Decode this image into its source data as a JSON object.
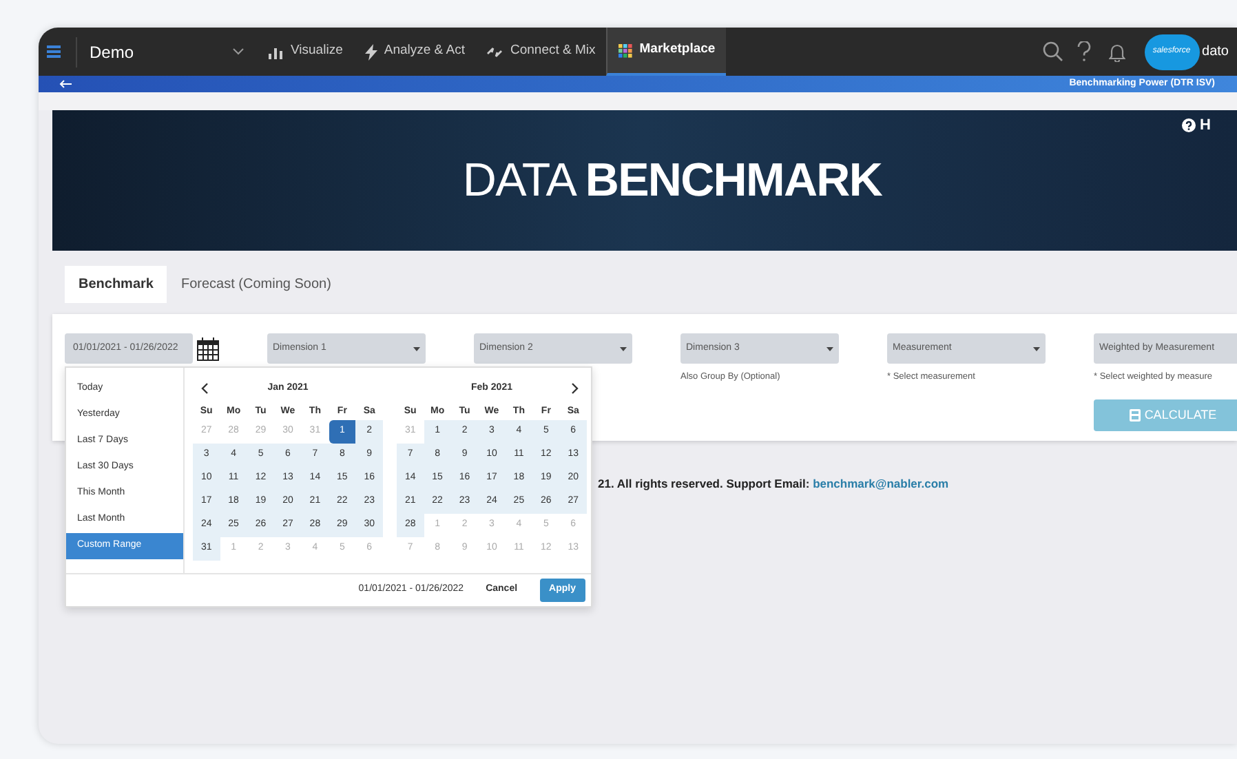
{
  "top_nav": {
    "workspace": "Demo",
    "items": [
      {
        "label": "Visualize",
        "kind": "bars",
        "selected": false
      },
      {
        "label": "Analyze & Act",
        "kind": "bolt",
        "selected": false
      },
      {
        "label": "Connect & Mix",
        "kind": "connect",
        "selected": false
      },
      {
        "label": "Marketplace",
        "kind": "grid",
        "selected": true
      }
    ],
    "logo_text": "salesforce",
    "brand_text": "dato"
  },
  "sub_bar": {
    "title": "Benchmarking Power (DTR ISV)"
  },
  "banner": {
    "title_light": "DATA",
    "title_bold": "BENCHMARK",
    "help_label": "H"
  },
  "tabs": [
    {
      "label": "Benchmark",
      "selected": true
    },
    {
      "label": "Forecast (Coming Soon)",
      "selected": false
    }
  ],
  "form": {
    "date_value": "01/01/2021 - 01/26/2022",
    "fields": [
      {
        "label": "Dimension 1"
      },
      {
        "label": "Dimension 2"
      },
      {
        "label": "Dimension 3",
        "hint": "Also Group By (Optional)"
      },
      {
        "label": "Measurement",
        "hint": "* Select measurement"
      },
      {
        "label": "Weighted by Measurement",
        "hint": "* Select weighted by measure"
      }
    ],
    "calculate": "CALCULATE"
  },
  "footer": {
    "text": "21. All rights reserved. Support Email:",
    "email": "benchmark@nabler.com"
  },
  "date_picker": {
    "ranges": [
      {
        "label": "Today",
        "selected": false
      },
      {
        "label": "Yesterday",
        "selected": false
      },
      {
        "label": "Last 7 Days",
        "selected": false
      },
      {
        "label": "Last 30 Days",
        "selected": false
      },
      {
        "label": "This Month",
        "selected": false
      },
      {
        "label": "Last Month",
        "selected": false
      },
      {
        "label": "Custom Range",
        "selected": true
      }
    ],
    "months": [
      {
        "title": "Jan 2021",
        "weekdays": [
          "Su",
          "Mo",
          "Tu",
          "We",
          "Th",
          "Fr",
          "Sa"
        ],
        "weeks": [
          [
            {
              "day": "27",
              "muted": true,
              "in_range": false,
              "selected": false
            },
            {
              "day": "28",
              "muted": true,
              "in_range": false,
              "selected": false
            },
            {
              "day": "29",
              "muted": true,
              "in_range": false,
              "selected": false
            },
            {
              "day": "30",
              "muted": true,
              "in_range": false,
              "selected": false
            },
            {
              "day": "31",
              "muted": true,
              "in_range": false,
              "selected": false
            },
            {
              "day": "1",
              "muted": false,
              "in_range": true,
              "selected": true
            },
            {
              "day": "2",
              "muted": false,
              "in_range": true,
              "selected": false
            }
          ],
          [
            {
              "day": "3",
              "muted": false,
              "in_range": true,
              "selected": false
            },
            {
              "day": "4",
              "muted": false,
              "in_range": true,
              "selected": false
            },
            {
              "day": "5",
              "muted": false,
              "in_range": true,
              "selected": false
            },
            {
              "day": "6",
              "muted": false,
              "in_range": true,
              "selected": false
            },
            {
              "day": "7",
              "muted": false,
              "in_range": true,
              "selected": false
            },
            {
              "day": "8",
              "muted": false,
              "in_range": true,
              "selected": false
            },
            {
              "day": "9",
              "muted": false,
              "in_range": true,
              "selected": false
            }
          ],
          [
            {
              "day": "10",
              "muted": false,
              "in_range": true,
              "selected": false
            },
            {
              "day": "11",
              "muted": false,
              "in_range": true,
              "selected": false
            },
            {
              "day": "12",
              "muted": false,
              "in_range": true,
              "selected": false
            },
            {
              "day": "13",
              "muted": false,
              "in_range": true,
              "selected": false
            },
            {
              "day": "14",
              "muted": false,
              "in_range": true,
              "selected": false
            },
            {
              "day": "15",
              "muted": false,
              "in_range": true,
              "selected": false
            },
            {
              "day": "16",
              "muted": false,
              "in_range": true,
              "selected": false
            }
          ],
          [
            {
              "day": "17",
              "muted": false,
              "in_range": true,
              "selected": false
            },
            {
              "day": "18",
              "muted": false,
              "in_range": true,
              "selected": false
            },
            {
              "day": "19",
              "muted": false,
              "in_range": true,
              "selected": false
            },
            {
              "day": "20",
              "muted": false,
              "in_range": true,
              "selected": false
            },
            {
              "day": "21",
              "muted": false,
              "in_range": true,
              "selected": false
            },
            {
              "day": "22",
              "muted": false,
              "in_range": true,
              "selected": false
            },
            {
              "day": "23",
              "muted": false,
              "in_range": true,
              "selected": false
            }
          ],
          [
            {
              "day": "24",
              "muted": false,
              "in_range": true,
              "selected": false
            },
            {
              "day": "25",
              "muted": false,
              "in_range": true,
              "selected": false
            },
            {
              "day": "26",
              "muted": false,
              "in_range": true,
              "selected": false
            },
            {
              "day": "27",
              "muted": false,
              "in_range": true,
              "selected": false
            },
            {
              "day": "28",
              "muted": false,
              "in_range": true,
              "selected": false
            },
            {
              "day": "29",
              "muted": false,
              "in_range": true,
              "selected": false
            },
            {
              "day": "30",
              "muted": false,
              "in_range": true,
              "selected": false
            }
          ],
          [
            {
              "day": "31",
              "muted": false,
              "in_range": true,
              "selected": false
            },
            {
              "day": "1",
              "muted": true,
              "in_range": false,
              "selected": false
            },
            {
              "day": "2",
              "muted": true,
              "in_range": false,
              "selected": false
            },
            {
              "day": "3",
              "muted": true,
              "in_range": false,
              "selected": false
            },
            {
              "day": "4",
              "muted": true,
              "in_range": false,
              "selected": false
            },
            {
              "day": "5",
              "muted": true,
              "in_range": false,
              "selected": false
            },
            {
              "day": "6",
              "muted": true,
              "in_range": false,
              "selected": false
            }
          ]
        ]
      },
      {
        "title": "Feb 2021",
        "weekdays": [
          "Su",
          "Mo",
          "Tu",
          "We",
          "Th",
          "Fr",
          "Sa"
        ],
        "weeks": [
          [
            {
              "day": "31",
              "muted": true,
              "in_range": false,
              "selected": false
            },
            {
              "day": "1",
              "muted": false,
              "in_range": true,
              "selected": false
            },
            {
              "day": "2",
              "muted": false,
              "in_range": true,
              "selected": false
            },
            {
              "day": "3",
              "muted": false,
              "in_range": true,
              "selected": false
            },
            {
              "day": "4",
              "muted": false,
              "in_range": true,
              "selected": false
            },
            {
              "day": "5",
              "muted": false,
              "in_range": true,
              "selected": false
            },
            {
              "day": "6",
              "muted": false,
              "in_range": true,
              "selected": false
            }
          ],
          [
            {
              "day": "7",
              "muted": false,
              "in_range": true,
              "selected": false
            },
            {
              "day": "8",
              "muted": false,
              "in_range": true,
              "selected": false
            },
            {
              "day": "9",
              "muted": false,
              "in_range": true,
              "selected": false
            },
            {
              "day": "10",
              "muted": false,
              "in_range": true,
              "selected": false
            },
            {
              "day": "11",
              "muted": false,
              "in_range": true,
              "selected": false
            },
            {
              "day": "12",
              "muted": false,
              "in_range": true,
              "selected": false
            },
            {
              "day": "13",
              "muted": false,
              "in_range": true,
              "selected": false
            }
          ],
          [
            {
              "day": "14",
              "muted": false,
              "in_range": true,
              "selected": false
            },
            {
              "day": "15",
              "muted": false,
              "in_range": true,
              "selected": false
            },
            {
              "day": "16",
              "muted": false,
              "in_range": true,
              "selected": false
            },
            {
              "day": "17",
              "muted": false,
              "in_range": true,
              "selected": false
            },
            {
              "day": "18",
              "muted": false,
              "in_range": true,
              "selected": false
            },
            {
              "day": "19",
              "muted": false,
              "in_range": true,
              "selected": false
            },
            {
              "day": "20",
              "muted": false,
              "in_range": true,
              "selected": false
            }
          ],
          [
            {
              "day": "21",
              "muted": false,
              "in_range": true,
              "selected": false
            },
            {
              "day": "22",
              "muted": false,
              "in_range": true,
              "selected": false
            },
            {
              "day": "23",
              "muted": false,
              "in_range": true,
              "selected": false
            },
            {
              "day": "24",
              "muted": false,
              "in_range": true,
              "selected": false
            },
            {
              "day": "25",
              "muted": false,
              "in_range": true,
              "selected": false
            },
            {
              "day": "26",
              "muted": false,
              "in_range": true,
              "selected": false
            },
            {
              "day": "27",
              "muted": false,
              "in_range": true,
              "selected": false
            }
          ],
          [
            {
              "day": "28",
              "muted": false,
              "in_range": true,
              "selected": false
            },
            {
              "day": "1",
              "muted": true,
              "in_range": false,
              "selected": false
            },
            {
              "day": "2",
              "muted": true,
              "in_range": false,
              "selected": false
            },
            {
              "day": "3",
              "muted": true,
              "in_range": false,
              "selected": false
            },
            {
              "day": "4",
              "muted": true,
              "in_range": false,
              "selected": false
            },
            {
              "day": "5",
              "muted": true,
              "in_range": false,
              "selected": false
            },
            {
              "day": "6",
              "muted": true,
              "in_range": false,
              "selected": false
            }
          ],
          [
            {
              "day": "7",
              "muted": true,
              "in_range": false,
              "selected": false
            },
            {
              "day": "8",
              "muted": true,
              "in_range": false,
              "selected": false
            },
            {
              "day": "9",
              "muted": true,
              "in_range": false,
              "selected": false
            },
            {
              "day": "10",
              "muted": true,
              "in_range": false,
              "selected": false
            },
            {
              "day": "11",
              "muted": true,
              "in_range": false,
              "selected": false
            },
            {
              "day": "12",
              "muted": true,
              "in_range": false,
              "selected": false
            },
            {
              "day": "13",
              "muted": true,
              "in_range": false,
              "selected": false
            }
          ]
        ]
      }
    ],
    "range_text": "01/01/2021 - 01/26/2022",
    "cancel": "Cancel",
    "apply": "Apply"
  }
}
